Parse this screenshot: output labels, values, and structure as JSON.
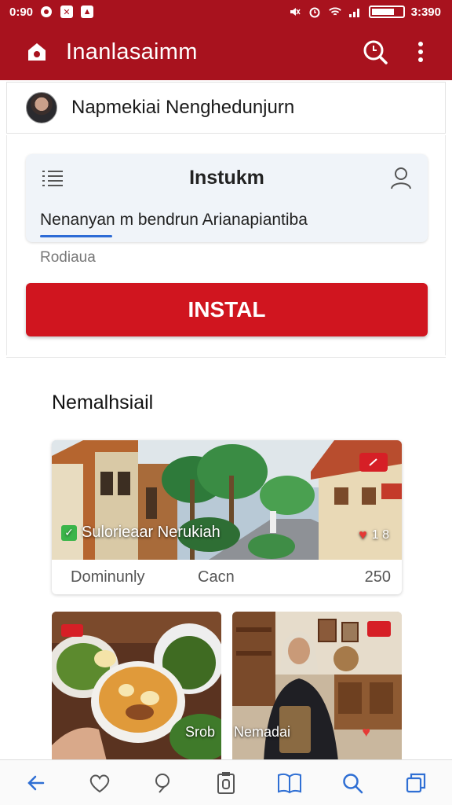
{
  "status_bar": {
    "time_left": "0:90",
    "time_right": "3:390",
    "icons_left": [
      "circle-icon",
      "x-app-icon",
      "notification-icon"
    ],
    "icons_right": [
      "mute-icon",
      "alarm-icon",
      "wifi-icon",
      "signal-icon",
      "battery-icon"
    ]
  },
  "app_bar": {
    "title": "Inanlasaimm",
    "icons": [
      "home-icon",
      "search-icon",
      "more-vert-icon"
    ],
    "accent_color": "#a8121e"
  },
  "profile": {
    "name": "Napmekiai Nenghedunjurn"
  },
  "install_panel": {
    "title": "Instukm",
    "field_value": "Nenanyan m bendrun Arianapiantiba",
    "helper_text": "Rodiaua",
    "install_label": "INSTAL",
    "button_color": "#d0151f"
  },
  "section": {
    "title": "Nemalhsiail"
  },
  "featured": {
    "overlay_label": "Sulorieaar Nerukiah",
    "stats": "1 8",
    "meta": [
      "Dominunly",
      "Cacn",
      "250"
    ]
  },
  "grid_cards": [
    {
      "caption": "Srob"
    },
    {
      "caption": "Nemadai"
    }
  ],
  "bottom_nav": [
    "back-icon",
    "heart-icon",
    "comment-icon",
    "clipboard-icon",
    "book-icon",
    "search-icon",
    "copy-icon"
  ]
}
